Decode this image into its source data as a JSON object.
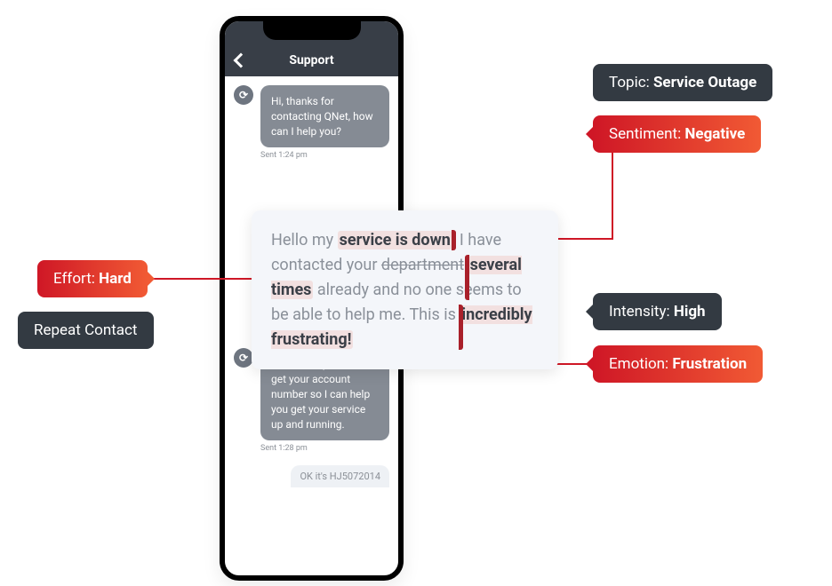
{
  "header": {
    "title": "Support"
  },
  "messages": {
    "agent1": {
      "text": "Hi, thanks for contacting QNet, how can I help you?",
      "sent": "Sent 1:24 pm"
    },
    "agent2": {
      "text": "Oh I'm sorry! Let me get your account number so I can help you get your service up and running.",
      "sent": "Sent 1:28 pm"
    },
    "user_truncated": "OK it's HJ5072014"
  },
  "user_message": {
    "p1a": "Hello my ",
    "hl1": "service is down",
    "p1b": ", I have contacted your ",
    "p2a_strike": "department",
    "hl2": "several times",
    "p2b": " already and no one seems to be able to help me. This is ",
    "hl3": "incredibly frustrating!"
  },
  "tags": {
    "topic": {
      "label": "Topic: ",
      "value": "Service Outage"
    },
    "sentiment": {
      "label": "Sentiment: ",
      "value": "Negative"
    },
    "intensity": {
      "label": "Intensity: ",
      "value": "High"
    },
    "emotion": {
      "label": "Emotion: ",
      "value": "Frustration"
    },
    "effort": {
      "label": "Effort: ",
      "value": "Hard"
    },
    "repeat": {
      "label": "Repeat Contact"
    }
  }
}
